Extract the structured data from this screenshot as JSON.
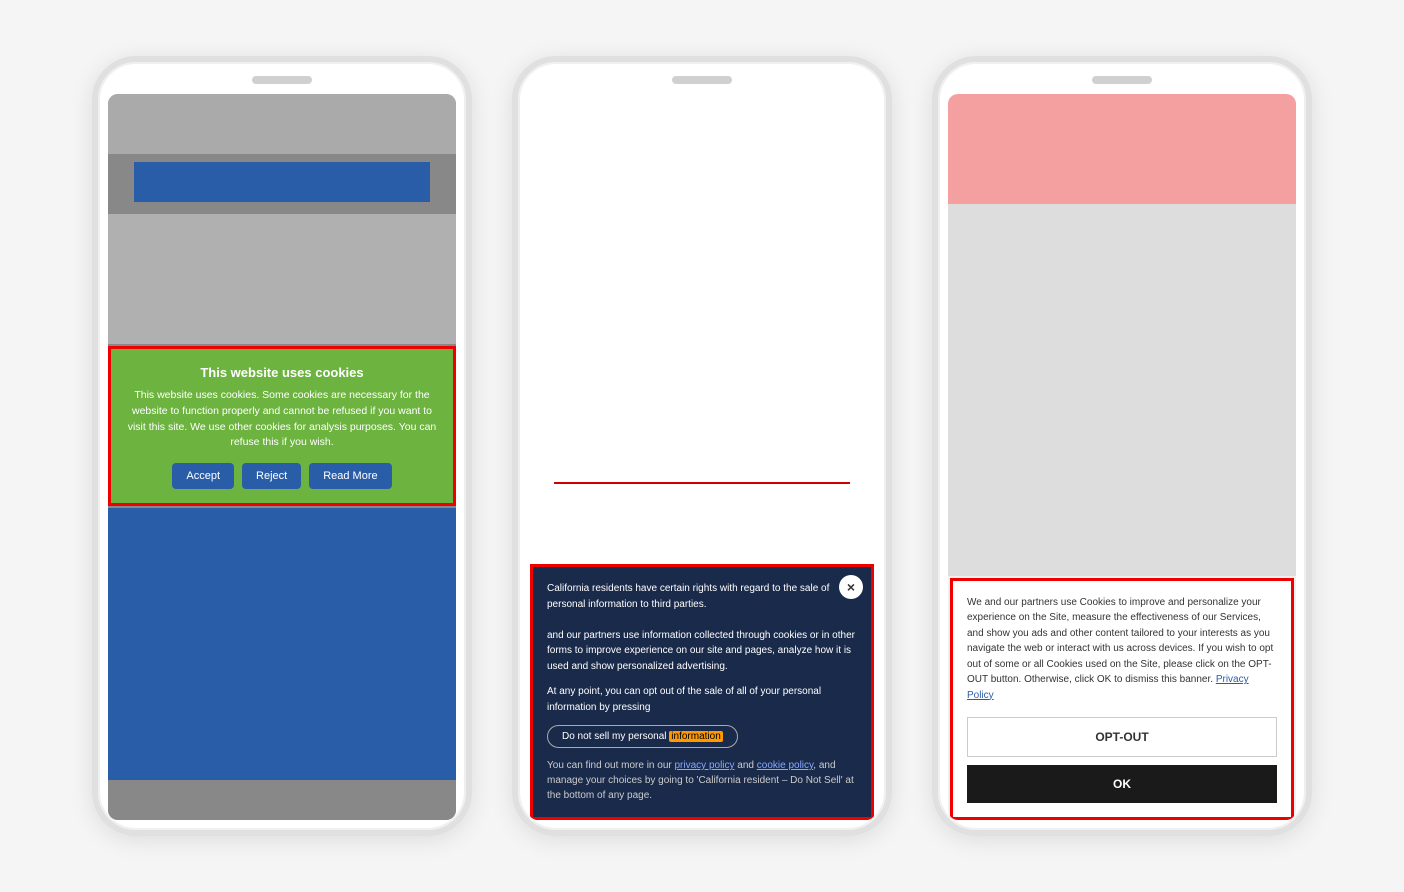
{
  "phone1": {
    "cookie_banner": {
      "title": "This website uses cookies",
      "text": "This website uses cookies. Some cookies are necessary for the website to function properly and cannot be refused if you want to visit this site. We use other cookies for analysis purposes. You can refuse this if you wish.",
      "accept_label": "Accept",
      "reject_label": "Reject",
      "read_more_label": "Read More"
    }
  },
  "phone2": {
    "cookie_banner": {
      "main_text": "California residents have certain rights with regard to the sale of personal information to third parties.",
      "main_text2": "and our partners use information collected through cookies or in other forms to improve experience on our site and pages, analyze how it is used and show personalized advertising.",
      "opt_out_text": "At any point, you can opt out of the sale of all of your personal information by pressing",
      "do_not_sell_label": "Do not sell my personal information",
      "bottom_text": "You can find out more in our privacy policy and cookie policy, and manage your choices by going to 'California resident – Do Not Sell' at the bottom of any page.",
      "close_icon": "×"
    }
  },
  "phone3": {
    "cookie_banner": {
      "text": "We and our partners use Cookies to improve and personalize your experience on the Site, measure the effectiveness of our Services, and show you ads and other content tailored to your interests as you navigate the web or interact with us across devices. If you wish to opt out of some or all Cookies used on the Site, please click on the OPT-OUT button. Otherwise, click OK to dismiss this banner.",
      "privacy_policy_label": "Privacy Policy",
      "opt_out_label": "OPT-OUT",
      "ok_label": "OK"
    }
  }
}
